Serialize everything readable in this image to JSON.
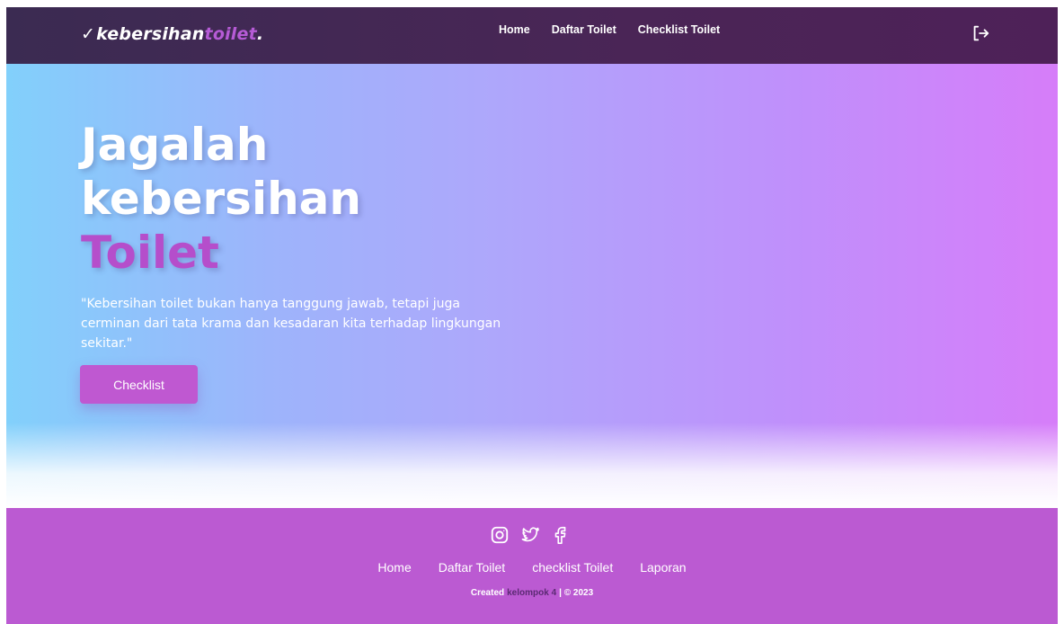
{
  "navbar": {
    "brand_check": "✓",
    "brand_main": "kebersihan",
    "brand_accent": "toilet",
    "brand_dot": ".",
    "links": [
      "Home",
      "Daftar Toilet",
      "Checklist Toilet"
    ],
    "logout_icon": "logout-icon"
  },
  "hero": {
    "title_line1": "Jagalah",
    "title_line2": "kebersihan",
    "title_accent": "Toilet",
    "quote": "\"Kebersihan toilet bukan hanya tanggung jawab, tetapi juga cerminan dari tata krama dan kesadaran kita terhadap lingkungan sekitar.\"",
    "button_label": "Checklist"
  },
  "footer": {
    "socials": [
      "instagram-icon",
      "twitter-icon",
      "facebook-icon"
    ],
    "links": [
      "Home",
      "Daftar Toilet",
      "checklist Toilet",
      "Laporan"
    ],
    "credit_prefix": "Created",
    "credit_team": "kelompok 4",
    "credit_suffix": "| © 2023"
  },
  "colors": {
    "navbar_bg": "#45264f",
    "accent": "#bb5ad2",
    "hero_left": "#82d0fb",
    "hero_right": "#d67df9",
    "footer_bg": "#bb5ad2"
  }
}
